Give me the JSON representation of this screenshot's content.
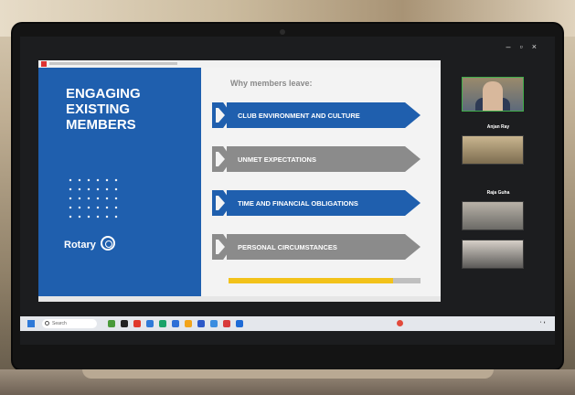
{
  "slide": {
    "title_lines": [
      "ENGAGING",
      "EXISTING",
      "MEMBERS"
    ],
    "logo_text": "Rotary",
    "heading": "Why members leave:",
    "items": [
      {
        "label": "CLUB ENVIRONMENT AND CULTURE",
        "style": "blue"
      },
      {
        "label": "UNMET EXPECTATIONS",
        "style": "gray"
      },
      {
        "label": "TIME AND FINANCIAL OBLIGATIONS",
        "style": "blue"
      },
      {
        "label": "PERSONAL CIRCUMSTANCES",
        "style": "gray"
      }
    ]
  },
  "participants": {
    "names": [
      "Anjan Ray",
      "Raja Guha"
    ]
  },
  "taskbar": {
    "search_placeholder": "Search"
  },
  "colors": {
    "slide_blue": "#1f5fae",
    "slide_gray": "#8b8b8b",
    "accent_yellow": "#f2c21a"
  }
}
